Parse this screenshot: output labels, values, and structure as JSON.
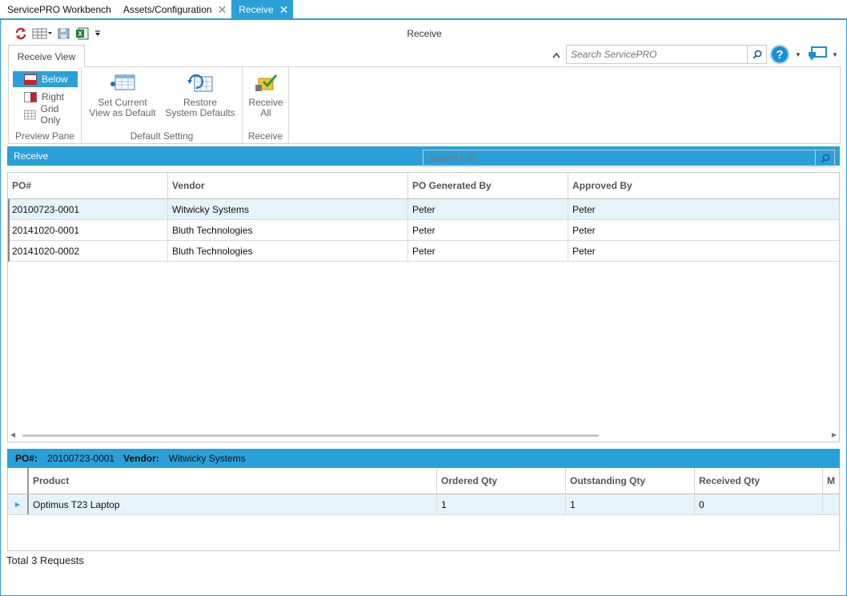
{
  "tabs": [
    {
      "label": "ServicePRO Workbench",
      "closable": false,
      "active": false
    },
    {
      "label": "Assets/Configuration",
      "closable": true,
      "active": false
    },
    {
      "label": "Receive",
      "closable": true,
      "active": true
    }
  ],
  "window_title": "Receive",
  "ribbon": {
    "tab_label": "Receive View",
    "preview_pane": {
      "label": "Preview Pane",
      "options": [
        "Below",
        "Right",
        "Grid Only"
      ],
      "selected": "Below"
    },
    "default_setting": {
      "label": "Default Setting",
      "set_current": [
        "Set Current",
        "View as Default"
      ],
      "restore": [
        "Restore",
        "System Defaults"
      ]
    },
    "receive_group": {
      "label": "Receive",
      "receive_all": [
        "Receive",
        "All"
      ]
    }
  },
  "search": {
    "placeholder": "Search ServicePRO"
  },
  "receive_section": {
    "title": "Receive",
    "search_placeholder": "Search List",
    "columns": [
      "PO#",
      "Vendor",
      "PO Generated By",
      "Approved By"
    ],
    "rows": [
      [
        "20100723-0001",
        "Witwicky Systems",
        "Peter",
        "Peter"
      ],
      [
        "20141020-0001",
        "Bluth Technologies",
        "Peter",
        "Peter"
      ],
      [
        "20141020-0002",
        "Bluth Technologies",
        "Peter",
        "Peter"
      ]
    ],
    "selected_row": 0
  },
  "detail": {
    "po_label": "PO#:",
    "po_value": "20100723-0001",
    "vendor_label": "Vendor:",
    "vendor_value": "Witwicky Systems",
    "columns": [
      "Product",
      "Ordered Qty",
      "Outstanding Qty",
      "Received Qty",
      "M"
    ],
    "rows": [
      [
        "Optimus T23 Laptop",
        "1",
        "1",
        "0",
        ""
      ]
    ]
  },
  "footer": {
    "status": "Total 3 Requests"
  },
  "colors": {
    "accent": "#2aa0d8",
    "selected_row": "#e5f3fb",
    "help_blue": "#1a8fd6"
  }
}
